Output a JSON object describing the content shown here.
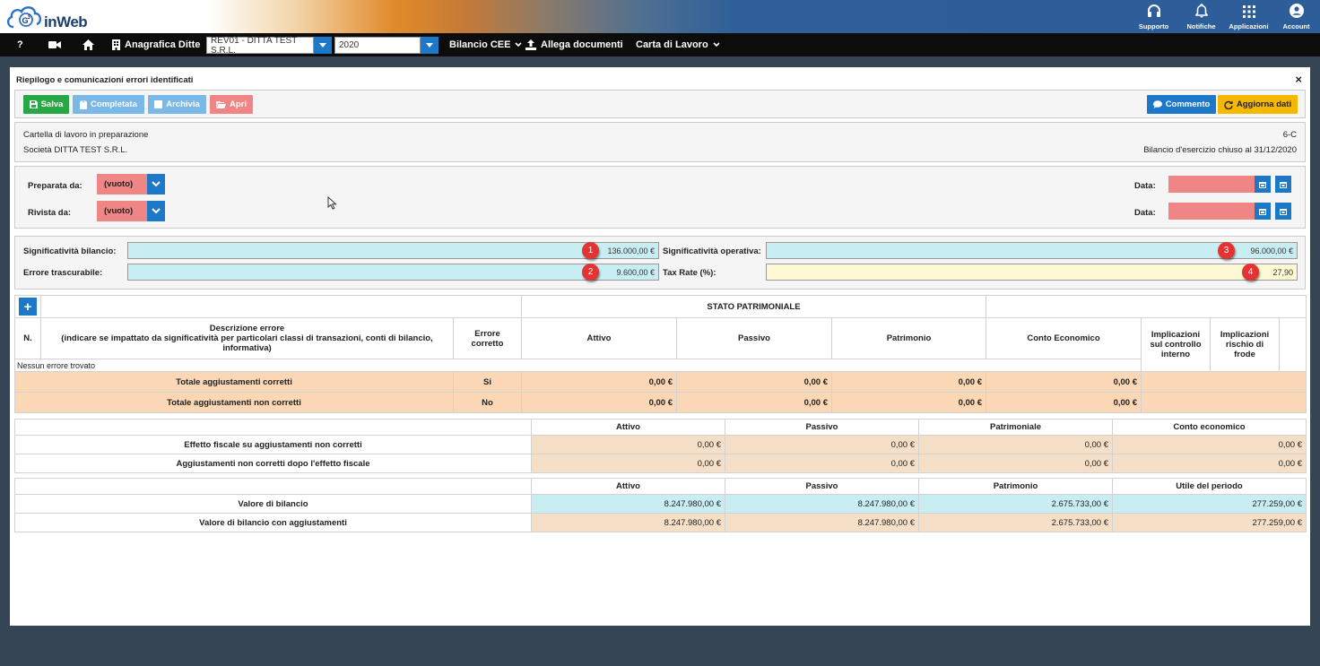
{
  "header": {
    "logo_text": "inWeb",
    "actions": [
      {
        "label": "Supporto",
        "icon": "headset-icon"
      },
      {
        "label": "Notifiche",
        "icon": "bell-icon"
      },
      {
        "label": "Applicazioni",
        "icon": "apps-grid-icon"
      },
      {
        "label": "Account",
        "icon": "account-icon"
      }
    ]
  },
  "nav": {
    "help": "?",
    "anagrafica": "Anagrafica Ditte",
    "company_select": "REV01 - DITTA TEST S.R.L.",
    "year_select": "2020",
    "bilancio": "Bilancio CEE",
    "allega": "Allega documenti",
    "carta": "Carta di Lavoro"
  },
  "panel": {
    "title": "Riepilogo e comunicazioni errori identificati",
    "close": "×"
  },
  "toolbar": {
    "save": "Salva",
    "completed": "Completata",
    "archive": "Archivia",
    "open": "Apri",
    "comment": "Commento",
    "refresh": "Aggiorna dati",
    "colors": {
      "save": "#28a745",
      "completed": "#7ab8e8",
      "archive": "#7ab8e8",
      "open": "#ef8585",
      "comment": "#1e78c8",
      "refresh": "#f5b800"
    }
  },
  "info": {
    "status": "Cartella di lavoro in preparazione",
    "code": "6-C",
    "company": "Società DITTA TEST S.R.L.",
    "closing": "Bilancio d'esercizio chiuso al 31/12/2020"
  },
  "review": {
    "prepared_label": "Preparata da:",
    "prepared_value": "(vuoto)",
    "reviewed_label": "Rivista da:",
    "reviewed_value": "(vuoto)",
    "date_label": "Data:"
  },
  "materiality": {
    "balance_label": "Significatività bilancio:",
    "balance_value": "136.000,00 €",
    "operational_label": "Significatività operativa:",
    "operational_value": "96.000,00 €",
    "trivial_label": "Errore trascurabile:",
    "trivial_value": "9.600,00 €",
    "tax_label": "Tax Rate (%):",
    "tax_value": "27,90",
    "badges": [
      "1",
      "2",
      "3",
      "4"
    ]
  },
  "errors_table": {
    "add": "+",
    "group_header": "STATO PATRIMONIALE",
    "headers": {
      "n": "N.",
      "desc_1": "Descrizione errore",
      "desc_2": "(indicare se impattato da significatività per particolari classi di transazioni, conti di bilancio, informativa)",
      "corrected_1": "Errore",
      "corrected_2": "corretto",
      "attivo": "Attivo",
      "passivo": "Passivo",
      "patrimonio": "Patrimonio",
      "ce": "Conto Economico",
      "ctrl_1": "Implicazioni",
      "ctrl_2": "sul controllo",
      "ctrl_3": "interno",
      "fraud_1": "Implicazioni",
      "fraud_2": "rischio di",
      "fraud_3": "frode"
    },
    "empty": "Nessun errore trovato",
    "totals": [
      {
        "label": "Totale aggiustamenti corretti",
        "flag": "Si",
        "attivo": "0,00 €",
        "passivo": "0,00 €",
        "patrimonio": "0,00 €",
        "ce": "0,00 €"
      },
      {
        "label": "Totale aggiustamenti non corretti",
        "flag": "No",
        "attivo": "0,00 €",
        "passivo": "0,00 €",
        "patrimonio": "0,00 €",
        "ce": "0,00 €"
      }
    ]
  },
  "tax_table": {
    "headers": [
      "Attivo",
      "Passivo",
      "Patrimoniale",
      "Conto economico"
    ],
    "rows": [
      {
        "label": "Effetto fiscale su aggiustamenti non corretti",
        "values": [
          "0,00 €",
          "0,00 €",
          "0,00 €",
          "0,00 €"
        ]
      },
      {
        "label": "Aggiustamenti non corretti dopo l'effetto fiscale",
        "values": [
          "0,00 €",
          "0,00 €",
          "0,00 €",
          "0,00 €"
        ]
      }
    ]
  },
  "balance_table": {
    "headers": [
      "Attivo",
      "Passivo",
      "Patrimonio",
      "Utile del periodo"
    ],
    "rows": [
      {
        "label": "Valore di bilancio",
        "values": [
          "8.247.980,00 €",
          "8.247.980,00 €",
          "2.675.733,00 €",
          "277.259,00 €"
        ]
      },
      {
        "label": "Valore di bilancio con aggiustamenti",
        "values": [
          "8.247.980,00 €",
          "8.247.980,00 €",
          "2.675.733,00 €",
          "277.259,00 €"
        ]
      }
    ]
  }
}
